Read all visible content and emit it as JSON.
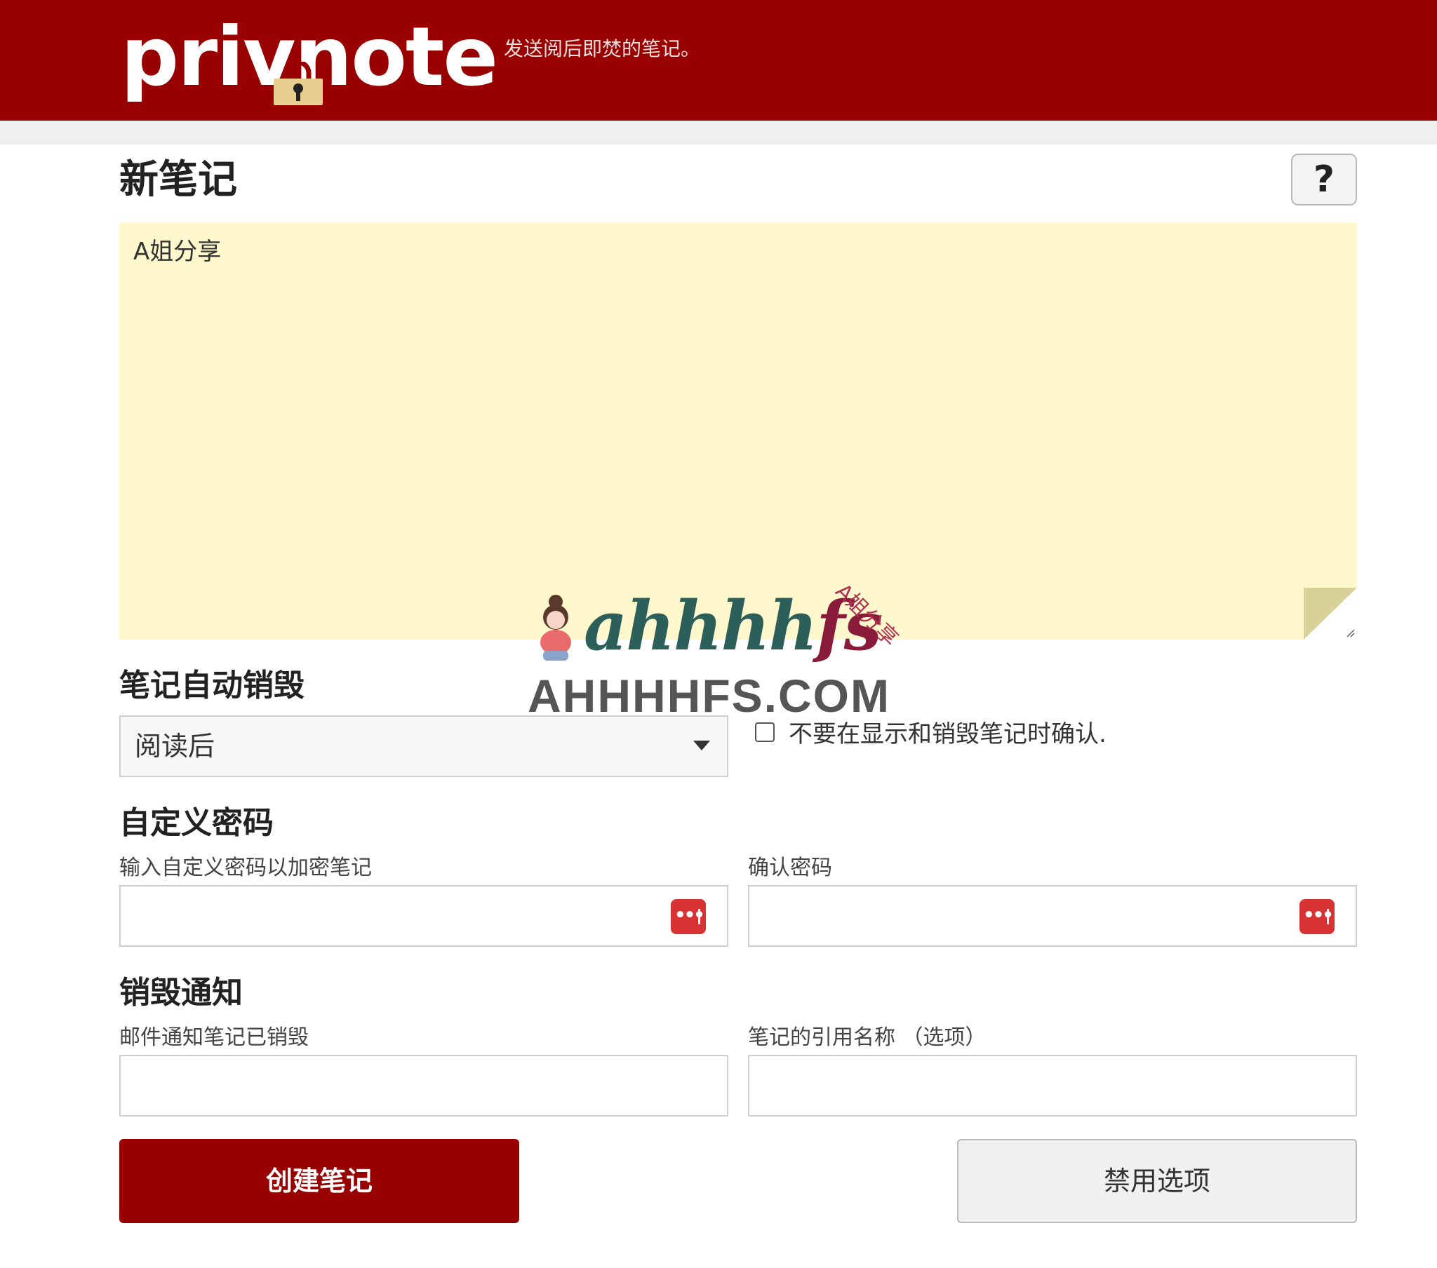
{
  "header": {
    "logo_text": "privnote",
    "tagline": "发送阅后即焚的笔记。",
    "brand_color": "#990000"
  },
  "new_note": {
    "title": "新笔记",
    "help_label": "?",
    "note_text": "A姐分享",
    "note_bg_color": "#fef8cc"
  },
  "watermark": {
    "script_text": "ahhhh",
    "script_text_end": "fs",
    "small_text": "A姐分享",
    "domain": "AHHHHFS.COM"
  },
  "self_destruct": {
    "title": "笔记自动销毁",
    "selected_option": "阅读后",
    "confirm_checkbox_label": "不要在显示和销毁笔记时确认."
  },
  "custom_password": {
    "title": "自定义密码",
    "password_label": "输入自定义密码以加密笔记",
    "confirm_label": "确认密码",
    "password_value": "",
    "confirm_value": ""
  },
  "destroy_notification": {
    "title": "销毁通知",
    "email_label": "邮件通知笔记已销毁",
    "reference_label": "笔记的引用名称 （选项）",
    "email_value": "",
    "reference_value": ""
  },
  "actions": {
    "create_label": "创建笔记",
    "disable_options_label": "禁用选项"
  }
}
